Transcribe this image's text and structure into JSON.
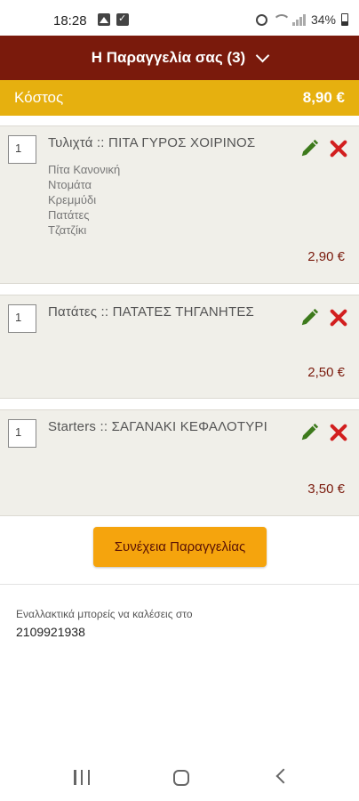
{
  "status_bar": {
    "time": "18:28",
    "battery": "34%"
  },
  "header": {
    "title": "Η Παραγγελία σας (3)"
  },
  "cost": {
    "label": "Κόστος",
    "value": "8,90 €"
  },
  "items": [
    {
      "qty": "1",
      "name": "Τυλιχτά :: ΠΙΤΑ ΓΥΡΟΣ ΧΟΙΡΙΝΟΣ",
      "options": [
        "Πίτα Κανονική",
        "Ντομάτα",
        "Κρεμμύδι",
        "Πατάτες",
        "Τζατζίκι"
      ],
      "price": "2,90 €"
    },
    {
      "qty": "1",
      "name": "Πατάτες :: ΠΑΤΑΤΕΣ ΤΗΓΑΝΗΤΕΣ",
      "options": [],
      "price": "2,50 €"
    },
    {
      "qty": "1",
      "name": "Starters :: ΣΑΓΑΝΑΚΙ ΚΕΦΑΛΟΤΥΡΙ",
      "options": [],
      "price": "3,50 €"
    }
  ],
  "continue_button": {
    "label": "Συνέχεια Παραγγελίας"
  },
  "footer": {
    "alt_text": "Εναλλακτικά μπορείς να καλέσεις στο",
    "phone": "2109921938"
  },
  "colors": {
    "header": "#7a1a0c",
    "cost_bar": "#e6b00f",
    "button": "#f5a40d",
    "edit_icon": "#3d7a1c",
    "delete_icon": "#d21f1f"
  }
}
